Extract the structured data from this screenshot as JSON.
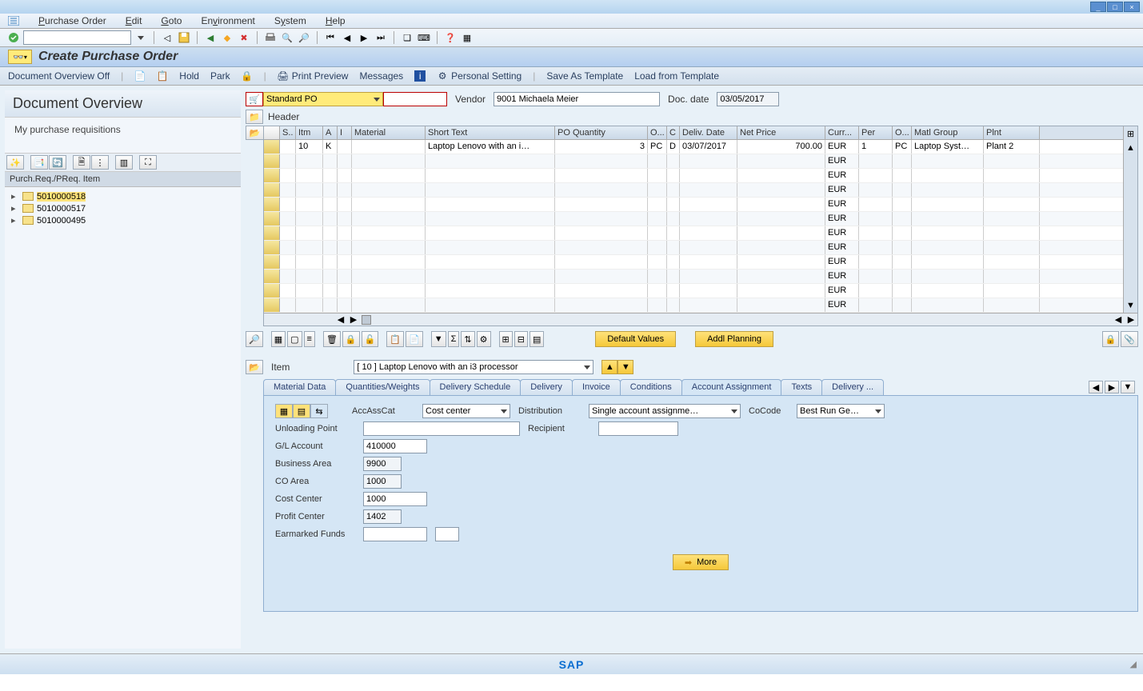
{
  "window": {
    "min": "_",
    "max": "□",
    "close": "×"
  },
  "menubar": [
    "Purchase Order",
    "Edit",
    "Goto",
    "Environment",
    "System",
    "Help"
  ],
  "title": "Create Purchase Order",
  "actions": {
    "doc_overview": "Document Overview Off",
    "hold": "Hold",
    "park": "Park",
    "print_preview": "Print Preview",
    "messages": "Messages",
    "personal_setting": "Personal Setting",
    "save_template": "Save As Template",
    "load_template": "Load from Template"
  },
  "overview": {
    "title": "Document Overview",
    "subtitle": "My purchase requisitions",
    "tree_header": "Purch.Req./PReq. Item",
    "items": [
      "5010000518",
      "5010000517",
      "5010000495"
    ]
  },
  "header": {
    "po_type": "Standard PO",
    "vendor_label": "Vendor",
    "vendor_value": "9001 Michaela Meier",
    "date_label": "Doc. date",
    "date_value": "03/05/2017",
    "collapsed": "Header"
  },
  "grid": {
    "columns": [
      "S..",
      "Itm",
      "A",
      "I",
      "Material",
      "Short Text",
      "PO Quantity",
      "O...",
      "C",
      "Deliv. Date",
      "Net Price",
      "Curr...",
      "Per",
      "O...",
      "Matl Group",
      "Plnt"
    ],
    "widths": [
      20,
      34,
      18,
      18,
      92,
      162,
      116,
      24,
      16,
      72,
      110,
      42,
      42,
      24,
      90,
      70
    ],
    "row": {
      "itm": "10",
      "a": "K",
      "short": "Laptop Lenovo with an i…",
      "qty": "3",
      "uom": "PC",
      "c": "D",
      "deliv": "03/07/2017",
      "price": "700.00",
      "curr": "EUR",
      "per": "1",
      "ouom": "PC",
      "matl": "Laptop Syst…",
      "plnt": "Plant 2"
    },
    "blank_curr": "EUR"
  },
  "item_toolbar": {
    "default": "Default Values",
    "addl": "Addl Planning"
  },
  "item_detail": {
    "label": "Item",
    "selected": "[ 10 ] Laptop Lenovo with an i3 processor"
  },
  "tabs": [
    "Material Data",
    "Quantities/Weights",
    "Delivery Schedule",
    "Delivery",
    "Invoice",
    "Conditions",
    "Account Assignment",
    "Texts",
    "Delivery ..."
  ],
  "active_tab": 6,
  "acct": {
    "accasscat_label": "AccAssCat",
    "accasscat_value": "Cost center",
    "dist_label": "Distribution",
    "dist_value": "Single account assignme…",
    "cocode_label": "CoCode",
    "cocode_value": "Best Run Ge…",
    "unload_label": "Unloading Point",
    "unload_value": "",
    "recip_label": "Recipient",
    "recip_value": "",
    "gl_label": "G/L Account",
    "gl_value": "410000",
    "ba_label": "Business Area",
    "ba_value": "9900",
    "co_label": "CO Area",
    "co_value": "1000",
    "cc_label": "Cost Center",
    "cc_value": "1000",
    "pc_label": "Profit Center",
    "pc_value": "1402",
    "ef_label": "Earmarked Funds",
    "ef_value": "",
    "more": "More"
  },
  "footer": {
    "logo": "SAP"
  }
}
